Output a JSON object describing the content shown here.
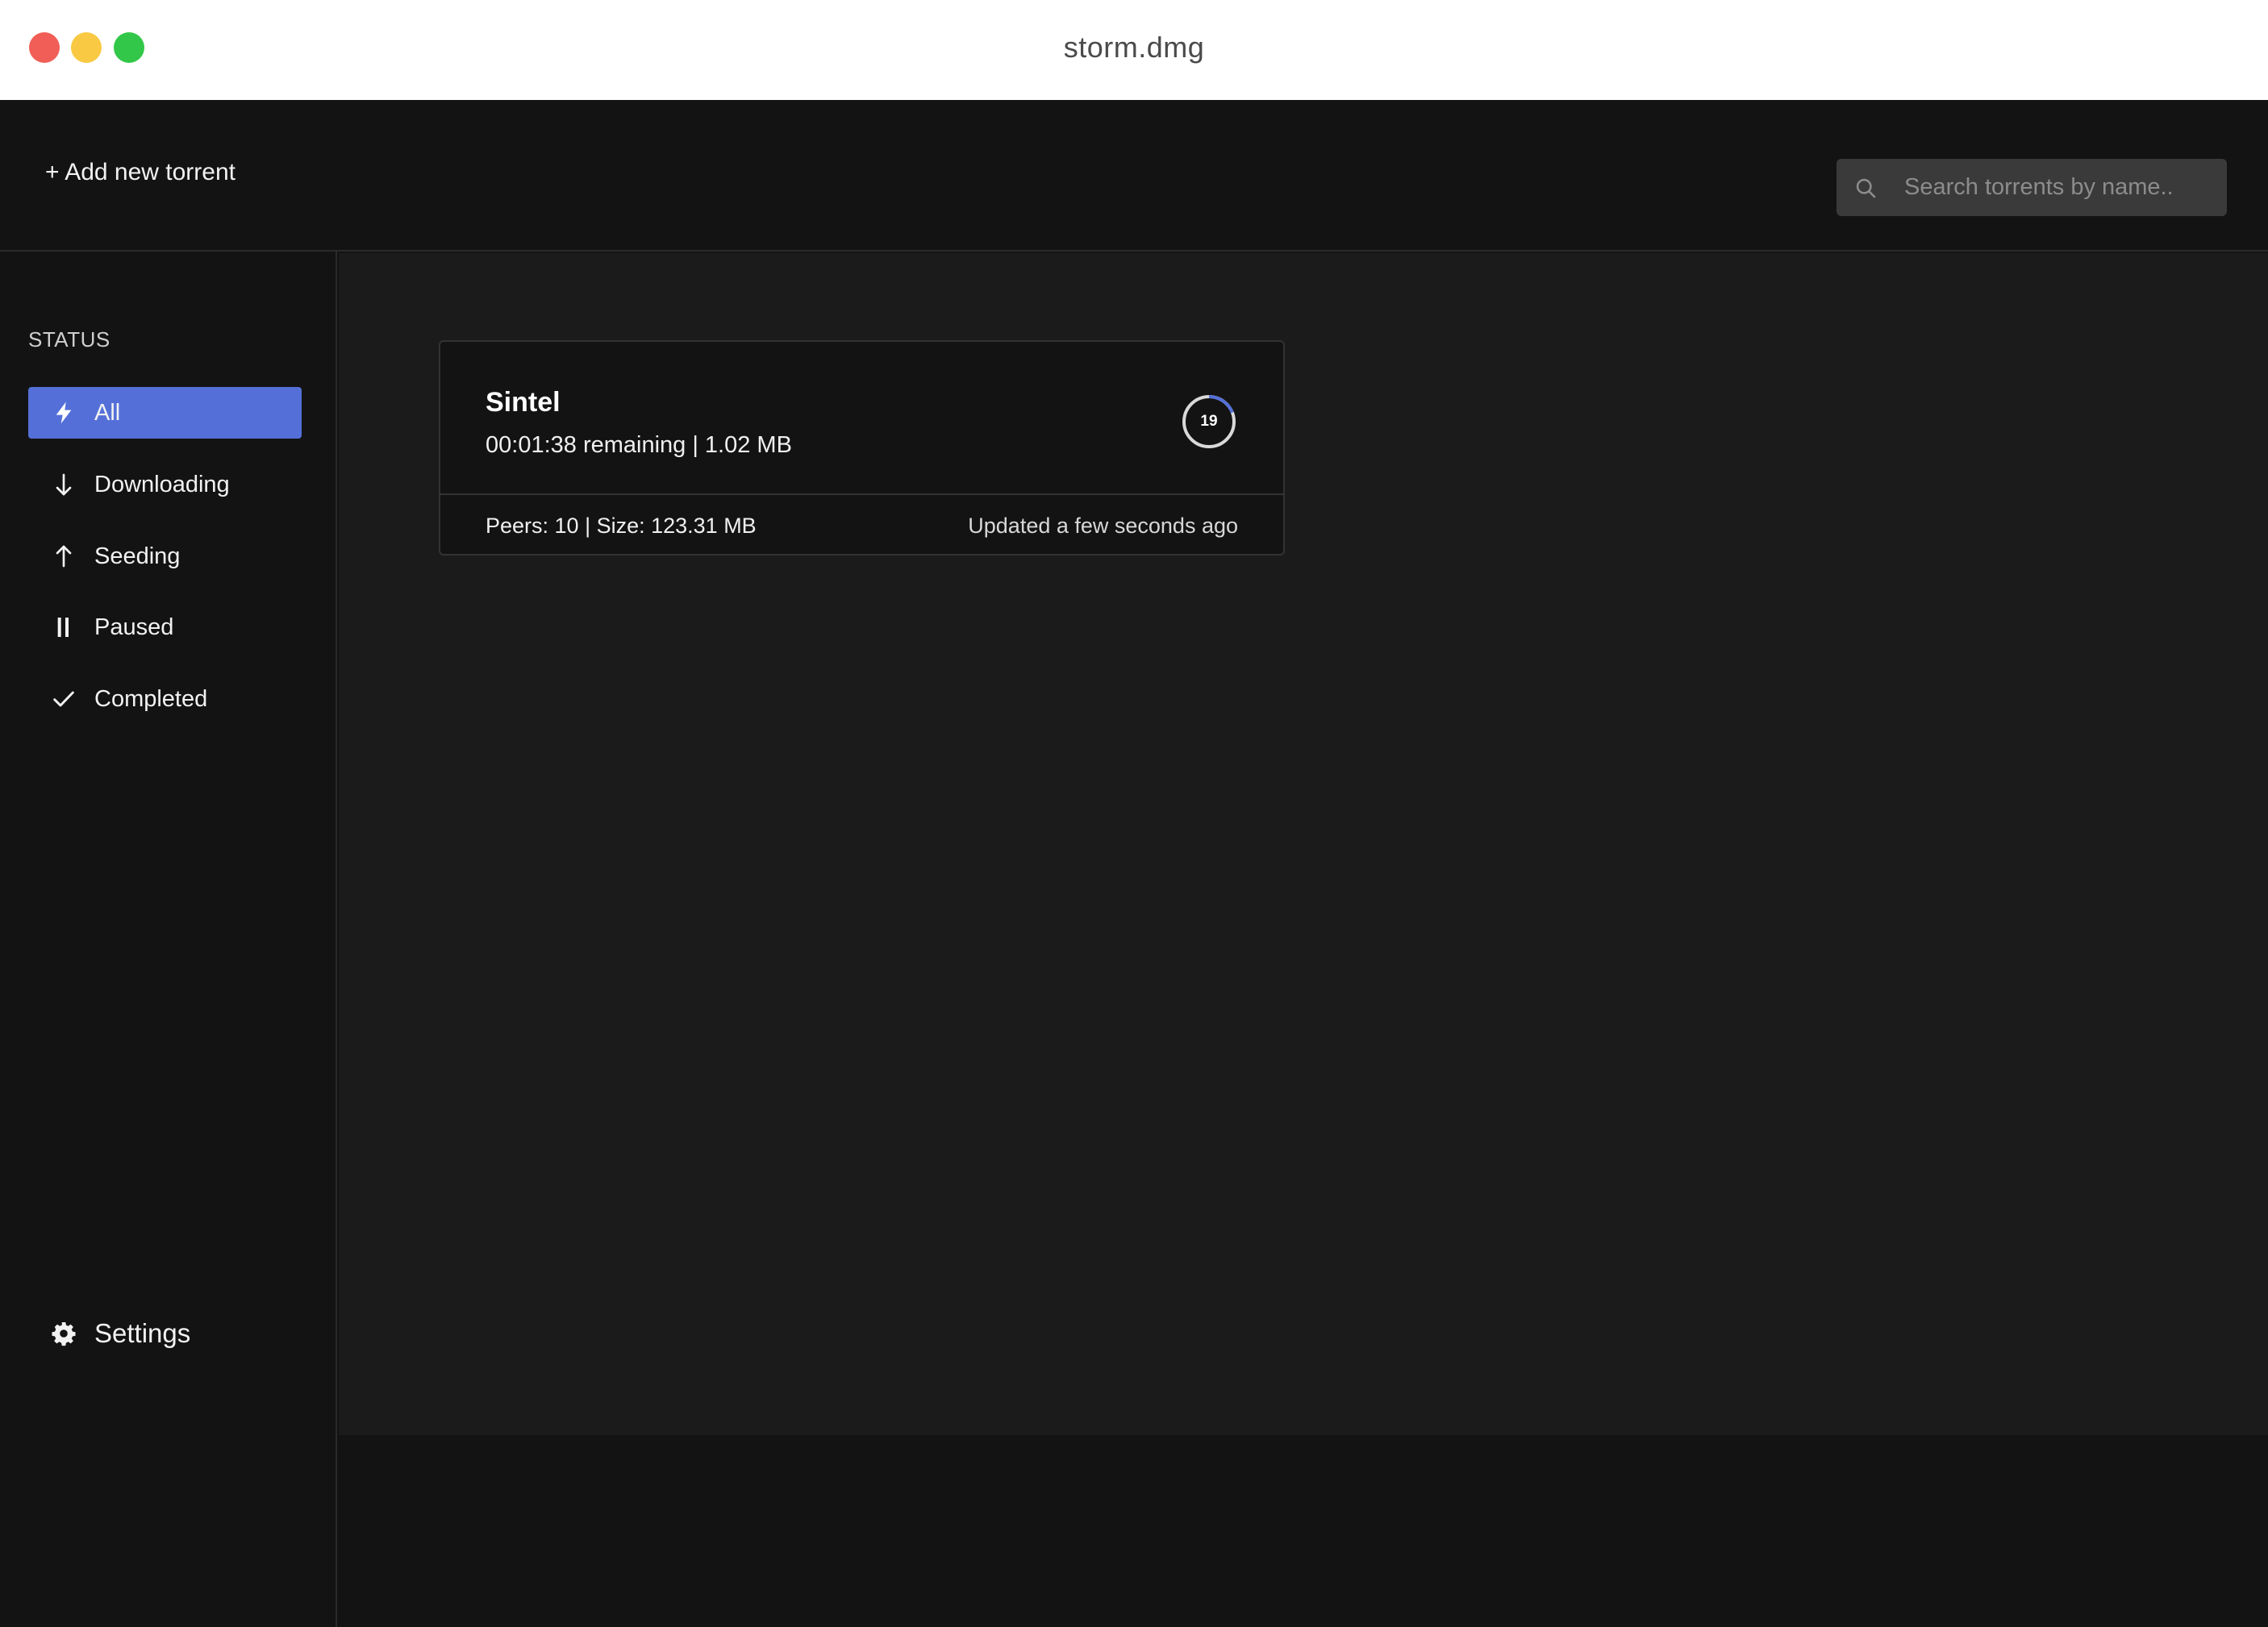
{
  "window": {
    "title": "storm.dmg"
  },
  "header": {
    "add_torrent_label": "+ Add new torrent",
    "search_placeholder": "Search torrents by name.."
  },
  "sidebar": {
    "heading": "STATUS",
    "items": [
      {
        "label": "All",
        "icon": "bolt-icon",
        "active": true
      },
      {
        "label": "Downloading",
        "icon": "arrow-down-icon",
        "active": false
      },
      {
        "label": "Seeding",
        "icon": "arrow-up-icon",
        "active": false
      },
      {
        "label": "Paused",
        "icon": "pause-icon",
        "active": false
      },
      {
        "label": "Completed",
        "icon": "check-icon",
        "active": false
      }
    ],
    "settings_label": "Settings"
  },
  "torrents": [
    {
      "name": "Sintel",
      "remaining": "00:01:38 remaining | 1.02 MB",
      "progress": 19,
      "footer_left": "Peers: 10 | Size: 123.31 MB",
      "footer_right": "Updated a few seconds ago"
    }
  ],
  "colors": {
    "accent": "#5470d8",
    "background": "#131313",
    "content_background": "#1b1b1b",
    "progress_track": "#d9d9d9",
    "progress_fill": "#5470d8"
  }
}
